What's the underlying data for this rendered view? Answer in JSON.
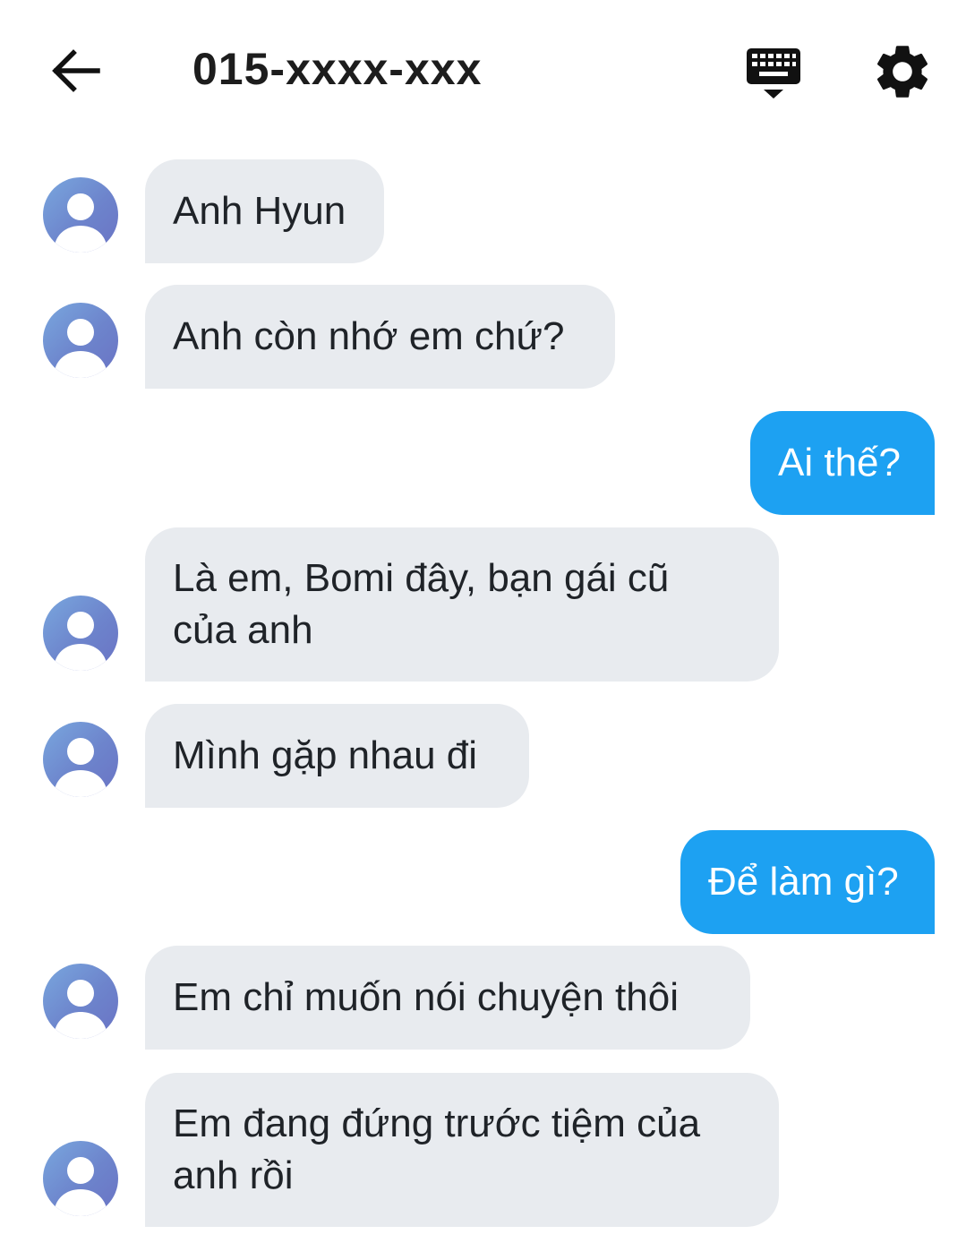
{
  "header": {
    "title": "015-xxxx-xxx",
    "back_icon": "arrow-left-icon",
    "keyboard_icon": "keyboard-hide-icon",
    "settings_icon": "gear-icon"
  },
  "colors": {
    "incoming_bubble": "#e8ebef",
    "outgoing_bubble": "#1da1f2",
    "outgoing_text": "#ffffff",
    "incoming_text": "#1f2328"
  },
  "messages": [
    {
      "direction": "incoming",
      "text": "Anh Hyun"
    },
    {
      "direction": "incoming",
      "text": "Anh còn nhớ em chứ?"
    },
    {
      "direction": "outgoing",
      "text": "Ai thế?"
    },
    {
      "direction": "incoming",
      "text": "Là em, Bomi đây, bạn gái cũ\ncủa anh"
    },
    {
      "direction": "incoming",
      "text": "Mình gặp nhau đi"
    },
    {
      "direction": "outgoing",
      "text": "Để làm gì?"
    },
    {
      "direction": "incoming",
      "text": "Em chỉ muốn nói chuyện thôi"
    },
    {
      "direction": "incoming",
      "text": "Em đang đứng trước tiệm của\nanh rồi"
    }
  ]
}
